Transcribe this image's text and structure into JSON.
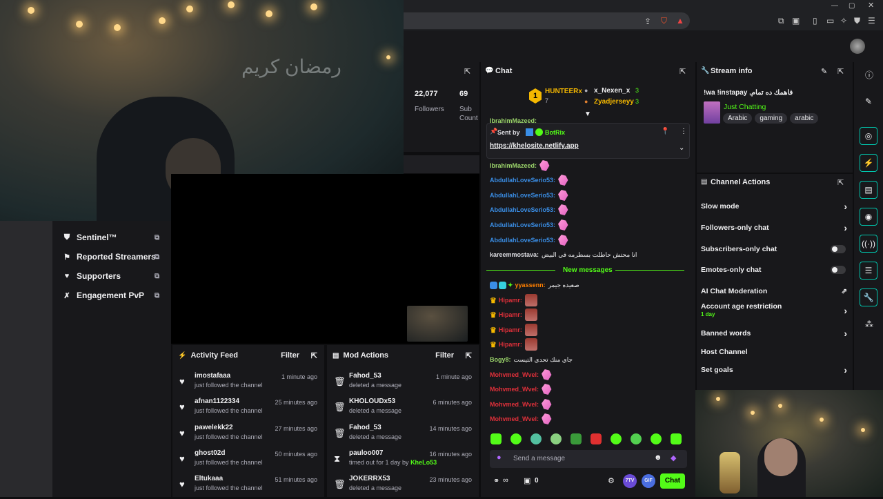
{
  "video_overlay": {
    "wall_text": "رمضان كريم"
  },
  "stats": {
    "followers_value": "22,077",
    "followers_label": "Followers",
    "sub_value": "69",
    "sub_label_1": "Sub",
    "sub_label_2": "Count"
  },
  "left_nav": [
    {
      "label": "Sentinel™",
      "icon": "shield-icon"
    },
    {
      "label": "Reported Streamers",
      "icon": "flag-icon"
    },
    {
      "label": "Supporters",
      "icon": "heart-icon"
    },
    {
      "label": "Engagement PvP",
      "icon": "swords-icon"
    }
  ],
  "activity_feed": {
    "title": "Activity Feed",
    "filter": "Filter",
    "items": [
      {
        "name": "imostafaaa",
        "sub": "just followed the channel",
        "time": "1 minute ago"
      },
      {
        "name": "afnan1122334",
        "sub": "just followed the channel",
        "time": "25 minutes ago"
      },
      {
        "name": "pawelekk22",
        "sub": "just followed the channel",
        "time": "27 minutes ago"
      },
      {
        "name": "ghost02d",
        "sub": "just followed the channel",
        "time": "50 minutes ago"
      },
      {
        "name": "Eltukaaa",
        "sub": "just followed the channel",
        "time": "51 minutes ago"
      }
    ]
  },
  "mod_actions": {
    "title": "Mod Actions",
    "filter": "Filter",
    "items": [
      {
        "name": "Fahod_53",
        "sub": "deleted a message",
        "time": "1 minute ago",
        "icon": "trash-icon"
      },
      {
        "name": "KHOLOUDx53",
        "sub": "deleted a message",
        "time": "6 minutes ago",
        "icon": "trash-icon"
      },
      {
        "name": "Fahod_53",
        "sub": "deleted a message",
        "time": "14 minutes ago",
        "icon": "trash-icon"
      },
      {
        "name": "pauloo007",
        "sub": "timed out for 1 day by",
        "sub_by": "KheLo53",
        "time": "16 minutes ago",
        "icon": "hourglass-icon"
      },
      {
        "name": "JOKERRX53",
        "sub": "deleted a message",
        "time": "23 minutes ago",
        "icon": "trash-icon"
      }
    ]
  },
  "chat": {
    "title": "Chat",
    "leaderboard": {
      "first_name": "HUNTEERx",
      "first_count": "7",
      "second_name": "x_Nexen_x",
      "second_count": "3",
      "third_name": "Zyadjerseyy",
      "third_count": "3"
    },
    "truncated_name": "IbrahimMazeed:",
    "pinned": {
      "sent_by": "Sent by",
      "bot": "BotRix",
      "link": "https://khelosite.netlify.app"
    },
    "messages": [
      {
        "user": "IbrahimMazeed:",
        "color": "#9bd46b",
        "text": ""
      },
      {
        "user": "AbdullahLoveSerio53:",
        "color": "#3a8ee6",
        "text": ""
      },
      {
        "user": "AbdullahLoveSerio53:",
        "color": "#3a8ee6",
        "text": ""
      },
      {
        "user": "AbdullahLoveSerio53:",
        "color": "#3a8ee6",
        "text": ""
      },
      {
        "user": "AbdullahLoveSerio53:",
        "color": "#3a8ee6",
        "text": ""
      },
      {
        "user": "AbdullahLoveSerio53:",
        "color": "#3a8ee6",
        "text": ""
      },
      {
        "user": "kareemmostava:",
        "color": "#dedee3",
        "text": "انا محتش حاطلت بسطرمه في البيض"
      }
    ],
    "new_messages": "New messages",
    "messages2": [
      {
        "user": "yyassenn:",
        "color": "#ff7f00",
        "text": "صعيده جيمر"
      },
      {
        "user": "Hipamr:",
        "color": "#e0303a",
        "text": ""
      },
      {
        "user": "Hipamr:",
        "color": "#e0303a",
        "text": ""
      },
      {
        "user": "Hipamr:",
        "color": "#e0303a",
        "text": ""
      },
      {
        "user": "Hipamr:",
        "color": "#e0303a",
        "text": ""
      },
      {
        "user": "Bogy8:",
        "color": "#9bd46b",
        "text": "جاي منك تحدي التيست"
      },
      {
        "user": "Mohvmed_Wvel:",
        "color": "#e0303a",
        "text": ""
      },
      {
        "user": "Mohvmed_Wvel:",
        "color": "#e0303a",
        "text": ""
      },
      {
        "user": "Mohvmed_Wvel:",
        "color": "#e0303a",
        "text": ""
      },
      {
        "user": "Mohvmed_Wvel:",
        "color": "#e0303a",
        "text": ""
      }
    ],
    "input_placeholder": "Send a message",
    "points": "0",
    "chat_button": "Chat",
    "badge_7tv": "7TV",
    "badge_gif": "GIF"
  },
  "stream_info": {
    "title_label": "Stream info",
    "stream_title": "!wa !instapay ,فاهمك ده تمام",
    "category": "Just Chatting",
    "tags": [
      "Arabic",
      "gaming",
      "arabic"
    ]
  },
  "channel_actions": {
    "title": "Channel Actions",
    "items": [
      {
        "label": "Slow mode",
        "control": "chevron"
      },
      {
        "label": "Followers-only chat",
        "control": "chevron"
      },
      {
        "label": "Subscribers-only chat",
        "control": "toggle"
      },
      {
        "label": "Emotes-only chat",
        "control": "toggle"
      },
      {
        "label": "AI Chat Moderation",
        "control": "external"
      },
      {
        "label": "Account age restriction",
        "sub": "1 day",
        "control": "chevron"
      },
      {
        "label": "Banned words",
        "control": "chevron"
      },
      {
        "label": "Host Channel",
        "control": "none"
      },
      {
        "label": "Set goals",
        "control": "chevron"
      }
    ]
  },
  "colors": {
    "accent_green": "#53fc18",
    "rail_teal": "#00c8af",
    "chat_bg": "#18181b"
  }
}
